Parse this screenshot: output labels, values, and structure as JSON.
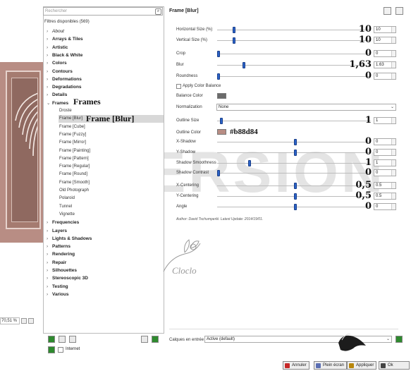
{
  "search": {
    "placeholder": "Rechercher"
  },
  "filters_header": "Filtres disponibles (569)",
  "categories_top": [
    {
      "label": "About",
      "italic": true
    },
    {
      "label": "Arrays & Tiles"
    },
    {
      "label": "Artistic"
    },
    {
      "label": "Black & White"
    },
    {
      "label": "Colors"
    },
    {
      "label": "Contours"
    },
    {
      "label": "Deformations"
    },
    {
      "label": "Degradations"
    },
    {
      "label": "Details"
    },
    {
      "label": "Frames"
    }
  ],
  "frames_sub": [
    "Droste",
    "Frame [Blur]",
    "Frame [Cube]",
    "Frame [Fuzzy]",
    "Frame [Mirror]",
    "Frame [Painting]",
    "Frame [Pattern]",
    "Frame [Regular]",
    "Frame [Round]",
    "Frame [Smooth]",
    "Old Photograph",
    "Polaroid",
    "Tunnel",
    "Vignette"
  ],
  "selected_sub_index": 1,
  "categories_bottom": [
    "Frequencies",
    "Layers",
    "Lights & Shadows",
    "Patterns",
    "Rendering",
    "Repair",
    "Silhouettes",
    "Stereoscopic 3D",
    "Testing",
    "Various"
  ],
  "annotations": {
    "frames": "Frames",
    "frame_blur": "Frame [Blur]",
    "outline_color": "#b88d84"
  },
  "zoom": "70,51 %",
  "internet_label": "Internet",
  "filter_title": "Frame [Blur]",
  "params": [
    {
      "label": "Horizontal Size (%)",
      "big": "10",
      "spin": "10",
      "pos": 0.1
    },
    {
      "label": "Vertical Size (%)",
      "big": "10",
      "spin": "10",
      "pos": 0.1
    },
    {
      "label": "Crop",
      "big": "0",
      "spin": "0",
      "pos": 0.0
    },
    {
      "label": "Blur",
      "big": "1,63",
      "spin": "1.63",
      "pos": 0.163
    },
    {
      "label": "Roundness",
      "big": "0",
      "spin": "0",
      "pos": 0.0
    }
  ],
  "apply_color_balance": "Apply Color Balance",
  "balance_color": "Balance Color",
  "normalization": {
    "label": "Normalization",
    "value": "None"
  },
  "outline_size": {
    "label": "Outline Size",
    "big": "1",
    "spin": "1",
    "pos": 0.02
  },
  "outline_color": {
    "label": "Outline Color",
    "color": "#b88d84"
  },
  "params2": [
    {
      "label": "X-Shadow",
      "big": "",
      "spin": "0",
      "pos": 0.5
    },
    {
      "label": "Y-Shadow",
      "big": "0",
      "spin": "0",
      "pos": 0.5
    },
    {
      "label": "Shadow Smoothness",
      "big": "1",
      "spin": "1",
      "pos": 0.2
    },
    {
      "label": "Shadow Contrast",
      "big": "0",
      "spin": "0",
      "pos": 0.0
    },
    {
      "label": "X-Centering",
      "big": "0,5",
      "spin": "0.5",
      "pos": 0.5
    },
    {
      "label": "Y-Centering",
      "big": "0,5",
      "spin": "0.5",
      "pos": 0.5
    },
    {
      "label": "Angle",
      "big": "0",
      "spin": "0",
      "pos": 0.5
    }
  ],
  "big_xshadow": "0",
  "author": "Author: David Tschumperlé.      Latest Update: 2014/19/01.",
  "watermark": "VERSION",
  "logo_text": "Cloclo",
  "layers": {
    "label": "Calques en entrée",
    "value": "Active (default)"
  },
  "buttons": {
    "cancel": "Annuler",
    "fullscreen": "Plein écran",
    "apply": "Appliquer",
    "ok": "Ok"
  }
}
